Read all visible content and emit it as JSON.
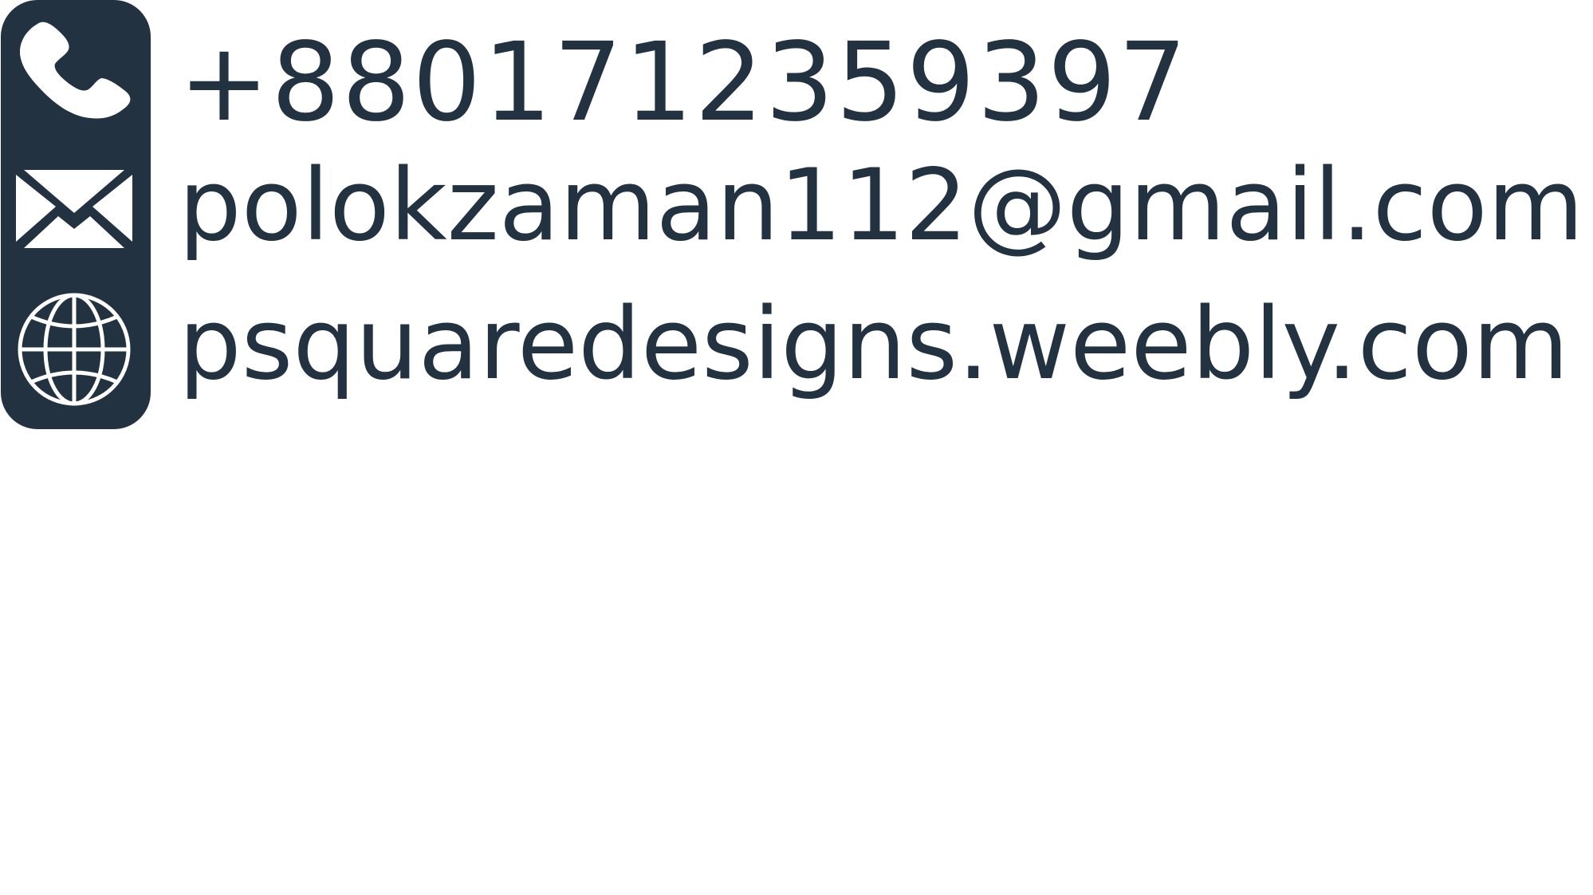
{
  "contact": {
    "phone": "+8801712359397",
    "email": "polokzaman112@gmail.com",
    "website": "psquaredesigns.weebly.com"
  },
  "icons": {
    "phone": "phone-icon",
    "email": "envelope-icon",
    "website": "globe-icon"
  },
  "colors": {
    "brand": "#223241",
    "icon_fill": "#ffffff",
    "background": "#ffffff"
  }
}
